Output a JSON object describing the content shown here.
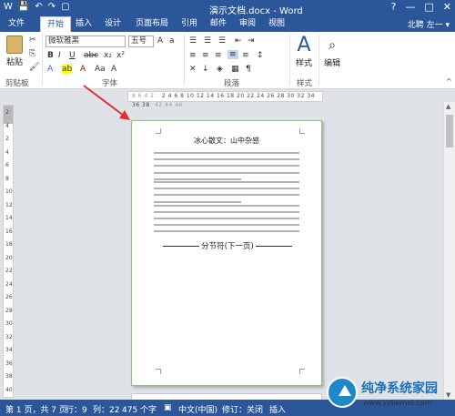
{
  "window": {
    "title": "演示文档.docx - Word",
    "user": "北聘 左一 ▾",
    "controls": [
      "?",
      "—",
      "□",
      "✕"
    ]
  },
  "tabs": [
    "文件",
    "开始",
    "插入",
    "设计",
    "页面布局",
    "引用",
    "邮件",
    "审阅",
    "视图"
  ],
  "ribbon": {
    "font_name": "微软雅黑",
    "font_size": "五号",
    "groups": {
      "clipboard": "剪贴板",
      "font": "字体",
      "paragraph": "段落",
      "styles": "样式",
      "editing": "编辑"
    },
    "paste_label": "粘贴",
    "styles_label": "样式",
    "editing_label": "编辑"
  },
  "ruler": {
    "left": "8 6 4 2",
    "main": "2 4 6 8 10 12 14 16 18 20 22 24 26 28 30 32 34 36 38",
    "right": "42 44 46",
    "vertical": [
      "2",
      "4",
      "2",
      "4",
      "6",
      "8",
      "10",
      "12",
      "14",
      "16",
      "18",
      "20",
      "22",
      "24",
      "26",
      "28",
      "30",
      "32",
      "34",
      "36",
      "38",
      "40"
    ]
  },
  "document": {
    "title": "冰心散文：山中杂感",
    "section_break": "分节符(下一页)"
  },
  "statusbar": {
    "page": "第 1 页，共 7 页",
    "row": "行：9",
    "col": "列：22",
    "words": "475 个字",
    "language": "中文(中国)",
    "track": "修订：关闭",
    "insert": "插入"
  },
  "watermark": {
    "brand": "纯净系统家园",
    "url": "www.yidaimei.com"
  },
  "colors": {
    "accent": "#2b579a",
    "arrow": "#e03030"
  }
}
